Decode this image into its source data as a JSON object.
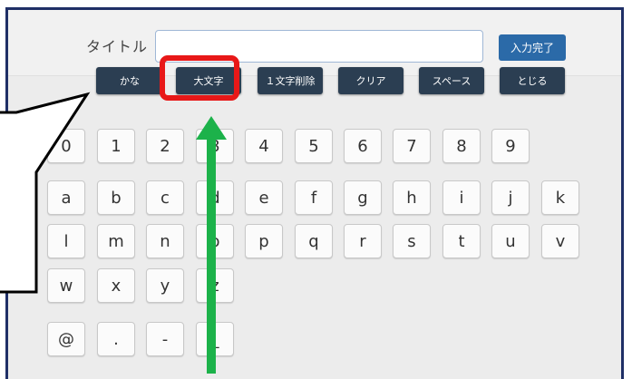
{
  "title_field": {
    "label": "タイトル",
    "value": ""
  },
  "done_button": "入力完了",
  "controls": [
    "かな",
    "大文字",
    "１文字削除",
    "クリア",
    "スペース",
    "とじる"
  ],
  "keys": {
    "row1": [
      "0",
      "1",
      "2",
      "3",
      "4",
      "5",
      "6",
      "7",
      "8",
      "9"
    ],
    "row2": [
      "a",
      "b",
      "c",
      "d",
      "e",
      "f",
      "g",
      "h",
      "i",
      "j",
      "k"
    ],
    "row3": [
      "l",
      "m",
      "n",
      "o",
      "p",
      "q",
      "r",
      "s",
      "t",
      "u",
      "v"
    ],
    "row4": [
      "w",
      "x",
      "y",
      "z"
    ],
    "row5": [
      "@",
      ".",
      "-",
      "_"
    ]
  },
  "annotation_colors": {
    "highlight": "#e81818",
    "arrow": "#1cb24a"
  }
}
